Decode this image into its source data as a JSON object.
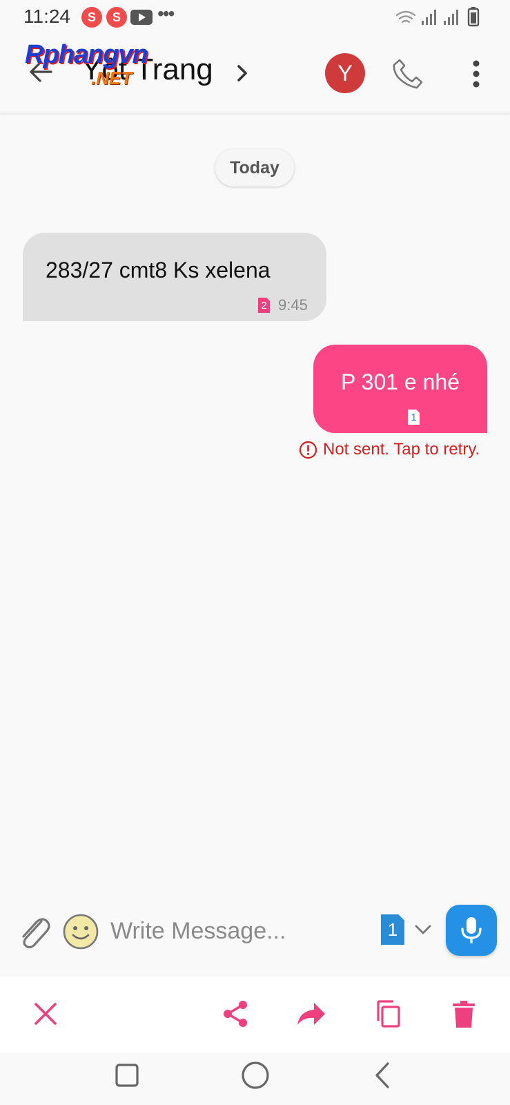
{
  "status_bar": {
    "time": "11:24",
    "notifications": [
      "S",
      "S"
    ]
  },
  "header": {
    "contact_name": "Yốt Trang",
    "avatar_initial": "Y",
    "watermark_top": "Rphangvn",
    "watermark_bottom": ".NET"
  },
  "conversation": {
    "date_label": "Today",
    "messages": [
      {
        "direction": "incoming",
        "text": "283/27 cmt8 Ks xelena",
        "sim": "2",
        "time": "9:45"
      },
      {
        "direction": "outgoing",
        "text": "P 301 e nhé",
        "sim": "1",
        "status": "Not sent. Tap to retry."
      }
    ]
  },
  "compose": {
    "placeholder": "Write Message...",
    "sim": "1"
  },
  "colors": {
    "accent_pink": "#fb4585",
    "action_pink": "#ee3f7f",
    "mic_blue": "#2491e7",
    "sim_blue": "#2a8bd6",
    "avatar_red": "#cf3a3a",
    "error_red": "#d41f1f"
  },
  "icons": {
    "header": [
      "back-arrow-icon",
      "chevron-right-icon",
      "phone-icon",
      "more-vert-icon"
    ],
    "compose": [
      "paperclip-icon",
      "emoji-icon",
      "chevron-down-icon",
      "mic-icon"
    ],
    "actions": [
      "close-icon",
      "share-icon",
      "forward-icon",
      "copy-icon",
      "delete-icon"
    ],
    "navigation": [
      "recents-icon",
      "home-icon",
      "back-icon"
    ]
  }
}
